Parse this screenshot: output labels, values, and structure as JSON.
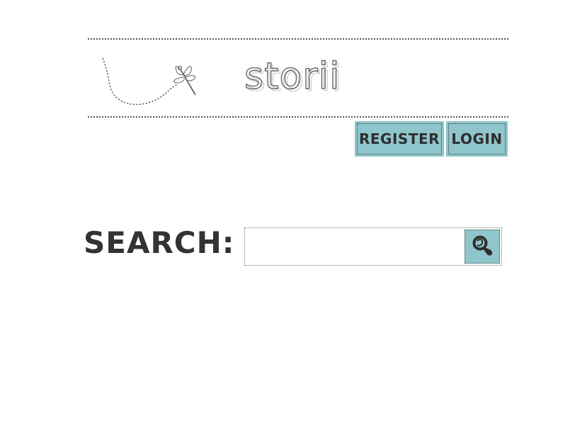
{
  "header": {
    "logo_text": "storii",
    "logo_icon": "dragonfly-icon"
  },
  "auth": {
    "register_label": "REGISTER",
    "login_label": "LOGIN",
    "button_color": "#8fc6cc"
  },
  "search": {
    "label": "SEARCH:",
    "value": "",
    "placeholder": "",
    "button_icon": "search-icon",
    "button_color": "#8fc6cc"
  }
}
